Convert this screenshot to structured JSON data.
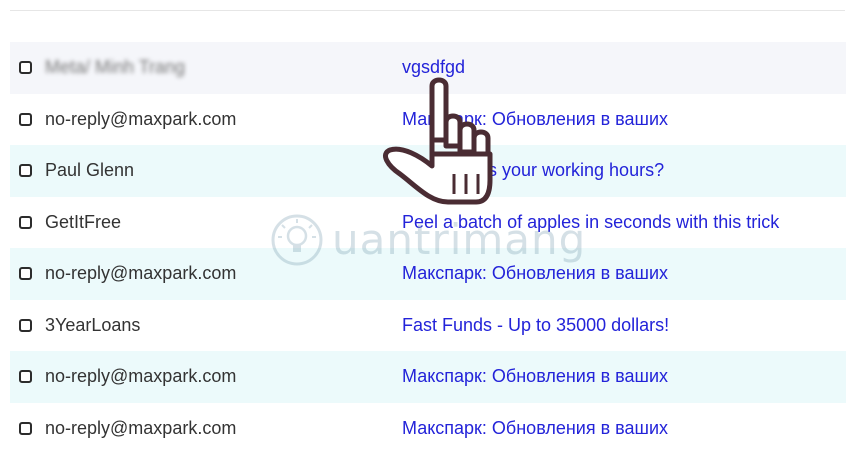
{
  "emails": [
    {
      "sender": "Meta/ Minh Trang",
      "subject": "vgsdfgd"
    },
    {
      "sender": "no-reply@maxpark.com",
      "subject": "Макспарк: Обновления в ваших"
    },
    {
      "sender": "Paul Glenn",
      "subject": "s your working hours?"
    },
    {
      "sender": "GetItFree",
      "subject": "Peel a batch of apples in seconds with this trick"
    },
    {
      "sender": "no-reply@maxpark.com",
      "subject": "Макспарк: Обновления в ваших"
    },
    {
      "sender": "3YearLoans",
      "subject": "Fast Funds - Up to 35000 dollars!"
    },
    {
      "sender": "no-reply@maxpark.com",
      "subject": "Макспарк: Обновления в ваших"
    },
    {
      "sender": "no-reply@maxpark.com",
      "subject": "Макспарк: Обновления в ваших"
    }
  ],
  "watermark": {
    "text": "uantrimang",
    "icon": "lightbulb-icon"
  },
  "cursor": {
    "icon": "hand-pointer-icon"
  },
  "colors": {
    "subject_link": "#2323d9",
    "sender_text": "#333333",
    "row_tint_a": "#f5f6fa",
    "row_tint_b": "#ecfafb"
  }
}
